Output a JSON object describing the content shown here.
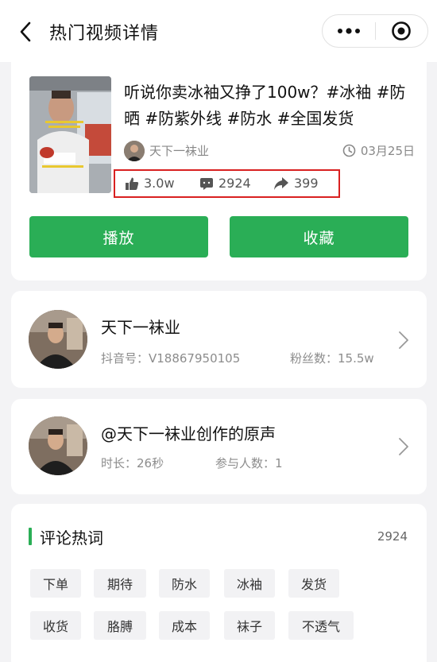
{
  "navbar": {
    "title": "热门视频详情",
    "back_icon": "chevron-left-icon",
    "more_icon": "more-dots-icon",
    "target_icon": "target-icon"
  },
  "video": {
    "title": "听说你卖冰袖又挣了100w？#冰袖 #防晒 #防紫外线 #防水 #全国发货",
    "author": "天下一袜业",
    "date": "03月25日",
    "likes": "3.0w",
    "comments": "2924",
    "shares": "399",
    "play_label": "播放",
    "collect_label": "收藏",
    "accent_color": "#2aae56",
    "highlight_color": "#d92121"
  },
  "author_card": {
    "name": "天下一袜业",
    "douyin_id_label": "抖音号：V18867950105",
    "fans_label": "粉丝数：15.5w"
  },
  "music_card": {
    "title": "@天下一袜业创作的原声",
    "duration_label": "时长：26秒",
    "participants_label": "参与人数：1"
  },
  "comment_words": {
    "title": "评论热词",
    "count": "2924",
    "words": [
      "下单",
      "期待",
      "防水",
      "冰袖",
      "发货",
      "收货",
      "胳膊",
      "成本",
      "袜子",
      "不透气"
    ]
  }
}
